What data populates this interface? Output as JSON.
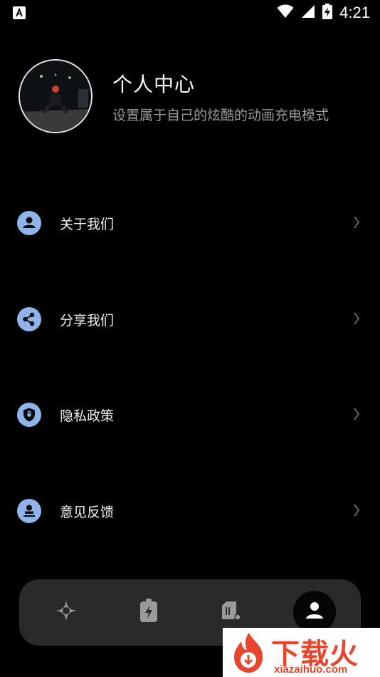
{
  "status_bar": {
    "time": "4:21",
    "left_icon": "a-box-icon",
    "wifi_icon": "wifi-icon",
    "signal_icon": "signal-icon",
    "battery_icon": "battery-charging-icon"
  },
  "profile": {
    "title": "个人中心",
    "subtitle": "设置属于自己的炫酷的动画充电模式"
  },
  "menu": {
    "items": [
      {
        "label": "关于我们",
        "icon": "person-icon"
      },
      {
        "label": "分享我们",
        "icon": "share-icon"
      },
      {
        "label": "隐私政策",
        "icon": "shield-icon"
      },
      {
        "label": "意见反馈",
        "icon": "feedback-stamp-icon"
      }
    ]
  },
  "bottom_nav": {
    "items": [
      {
        "icon": "sparkle-icon",
        "active": false
      },
      {
        "icon": "battery-bolt-icon",
        "active": false
      },
      {
        "icon": "card-icon",
        "active": false
      },
      {
        "icon": "person-icon",
        "active": true
      }
    ]
  },
  "watermark": {
    "text": "下载火",
    "sub": "xiazaihuo.com"
  },
  "colors": {
    "background": "#000000",
    "accent_icon_bg": "#8fb4ec",
    "nav_bg": "#2a2a2a",
    "watermark_red": "#e8452c"
  }
}
